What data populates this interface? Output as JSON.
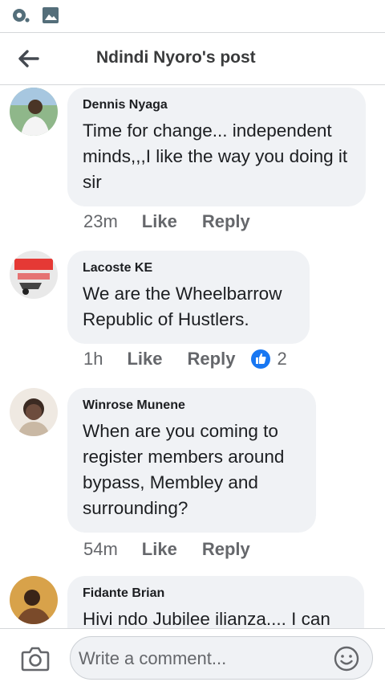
{
  "status_bar": {
    "icons": [
      "camera-notification-icon",
      "gallery-notification-icon"
    ]
  },
  "header": {
    "back_icon": "arrow-left-icon",
    "title": "Ndindi Nyoro's post"
  },
  "comments": [
    {
      "author": "Dennis Nyaga",
      "text": "Time for change... independent minds,,,I like the way you doing it sir",
      "time": "23m",
      "like_label": "Like",
      "reply_label": "Reply"
    },
    {
      "author": "Lacoste KE",
      "text": "We are the Wheelbarrow Republic of Hustlers.",
      "time": "1h",
      "like_label": "Like",
      "reply_label": "Reply",
      "reaction_icon": "thumbs-up-icon",
      "reaction_count": "2"
    },
    {
      "author": "Winrose Munene",
      "text": "When are you coming to register members around bypass, Membley and surrounding?",
      "time": "54m",
      "like_label": "Like",
      "reply_label": "Reply"
    },
    {
      "author": "Fidante Brian",
      "text": "Hivi ndo Jubilee ilianza.... I can",
      "time": "",
      "like_label": "",
      "reply_label": ""
    }
  ],
  "composer": {
    "camera_icon": "camera-icon",
    "placeholder": "Write a comment...",
    "emoji_icon": "smiley-icon"
  },
  "colors": {
    "bubble": "#f0f2f5",
    "meta_text": "#65676b",
    "like_blue": "#1877f2"
  }
}
